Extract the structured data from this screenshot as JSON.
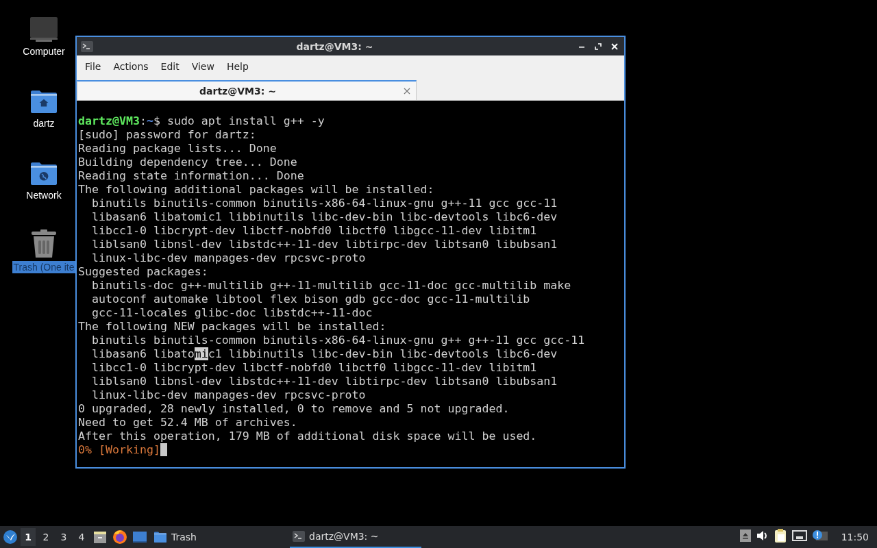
{
  "desktop_icons": [
    {
      "label": "Computer",
      "kind": "computer",
      "selected": false
    },
    {
      "label": "dartz",
      "kind": "home",
      "selected": false
    },
    {
      "label": "Network",
      "kind": "network",
      "selected": false
    },
    {
      "label": "Trash (One ite",
      "kind": "trash",
      "selected": true
    }
  ],
  "window": {
    "title": "dartz@VM3: ~",
    "menu": [
      "File",
      "Actions",
      "Edit",
      "View",
      "Help"
    ],
    "tabs": [
      {
        "label": "dartz@VM3: ~",
        "selected": true
      }
    ],
    "terminal": {
      "lines": [
        {
          "segments": [
            {
              "text": "dartz@VM3",
              "kind": "user"
            },
            {
              "text": ":",
              "kind": "plain"
            },
            {
              "text": "~",
              "kind": "path"
            },
            {
              "text": "$ sudo apt install g++ -y",
              "kind": "plain"
            }
          ]
        },
        {
          "segments": [
            {
              "text": "[sudo] password for dartz:",
              "kind": "plain"
            }
          ]
        },
        {
          "segments": [
            {
              "text": "Reading package lists... Done",
              "kind": "plain"
            }
          ]
        },
        {
          "segments": [
            {
              "text": "Building dependency tree... Done",
              "kind": "plain"
            }
          ]
        },
        {
          "segments": [
            {
              "text": "Reading state information... Done",
              "kind": "plain"
            }
          ]
        },
        {
          "segments": [
            {
              "text": "The following additional packages will be installed:",
              "kind": "plain"
            }
          ]
        },
        {
          "segments": [
            {
              "text": "  binutils binutils-common binutils-x86-64-linux-gnu g++-11 gcc gcc-11",
              "kind": "plain"
            }
          ]
        },
        {
          "segments": [
            {
              "text": "  libasan6 libatomic1 libbinutils libc-dev-bin libc-devtools libc6-dev",
              "kind": "plain"
            }
          ]
        },
        {
          "segments": [
            {
              "text": "  libcc1-0 libcrypt-dev libctf-nobfd0 libctf0 libgcc-11-dev libitm1",
              "kind": "plain"
            }
          ]
        },
        {
          "segments": [
            {
              "text": "  liblsan0 libnsl-dev libstdc++-11-dev libtirpc-dev libtsan0 libubsan1",
              "kind": "plain"
            }
          ]
        },
        {
          "segments": [
            {
              "text": "  linux-libc-dev manpages-dev rpcsvc-proto",
              "kind": "plain"
            }
          ]
        },
        {
          "segments": [
            {
              "text": "Suggested packages:",
              "kind": "plain"
            }
          ]
        },
        {
          "segments": [
            {
              "text": "  binutils-doc g++-multilib g++-11-multilib gcc-11-doc gcc-multilib make",
              "kind": "plain"
            }
          ]
        },
        {
          "segments": [
            {
              "text": "  autoconf automake libtool flex bison gdb gcc-doc gcc-11-multilib",
              "kind": "plain"
            }
          ]
        },
        {
          "segments": [
            {
              "text": "  gcc-11-locales glibc-doc libstdc++-11-doc",
              "kind": "plain"
            }
          ]
        },
        {
          "segments": [
            {
              "text": "The following NEW packages will be installed:",
              "kind": "plain"
            }
          ]
        },
        {
          "segments": [
            {
              "text": "  binutils binutils-common binutils-x86-64-linux-gnu g++ g++-11 gcc gcc-11",
              "kind": "plain"
            }
          ]
        },
        {
          "segments": [
            {
              "text": "  libasan6 libato",
              "kind": "plain"
            },
            {
              "text": "mi",
              "kind": "selected"
            },
            {
              "text": "c1 libbinutils libc-dev-bin libc-devtools libc6-dev",
              "kind": "plain"
            }
          ]
        },
        {
          "segments": [
            {
              "text": "  libcc1-0 libcrypt-dev libctf-nobfd0 libctf0 libgcc-11-dev libitm1",
              "kind": "plain"
            }
          ]
        },
        {
          "segments": [
            {
              "text": "  liblsan0 libnsl-dev libstdc++-11-dev libtirpc-dev libtsan0 libubsan1",
              "kind": "plain"
            }
          ]
        },
        {
          "segments": [
            {
              "text": "  linux-libc-dev manpages-dev rpcsvc-proto",
              "kind": "plain"
            }
          ]
        },
        {
          "segments": [
            {
              "text": "0 upgraded, 28 newly installed, 0 to remove and 5 not upgraded.",
              "kind": "plain"
            }
          ]
        },
        {
          "segments": [
            {
              "text": "Need to get 52.4 MB of archives.",
              "kind": "plain"
            }
          ]
        },
        {
          "segments": [
            {
              "text": "After this operation, 179 MB of additional disk space will be used.",
              "kind": "plain"
            }
          ]
        },
        {
          "segments": [
            {
              "text": "0% [Working]",
              "kind": "progress"
            }
          ],
          "cursor": true
        }
      ]
    }
  },
  "taskbar": {
    "workspaces": [
      {
        "label": "1",
        "selected": true
      },
      {
        "label": "2",
        "selected": false
      },
      {
        "label": "3",
        "selected": false
      },
      {
        "label": "4",
        "selected": false
      }
    ],
    "launchers": [
      {
        "kind": "files"
      },
      {
        "kind": "browser"
      },
      {
        "kind": "desktop"
      }
    ],
    "tasks": [
      {
        "label": "Trash",
        "kind": "folder",
        "selected": false
      },
      {
        "label": "dartz@VM3: ~",
        "kind": "terminal",
        "selected": true
      }
    ],
    "tray": [
      {
        "kind": "eject"
      },
      {
        "kind": "volume"
      },
      {
        "kind": "clipboard"
      },
      {
        "kind": "network"
      },
      {
        "kind": "notification"
      }
    ],
    "clock": "11:50"
  }
}
